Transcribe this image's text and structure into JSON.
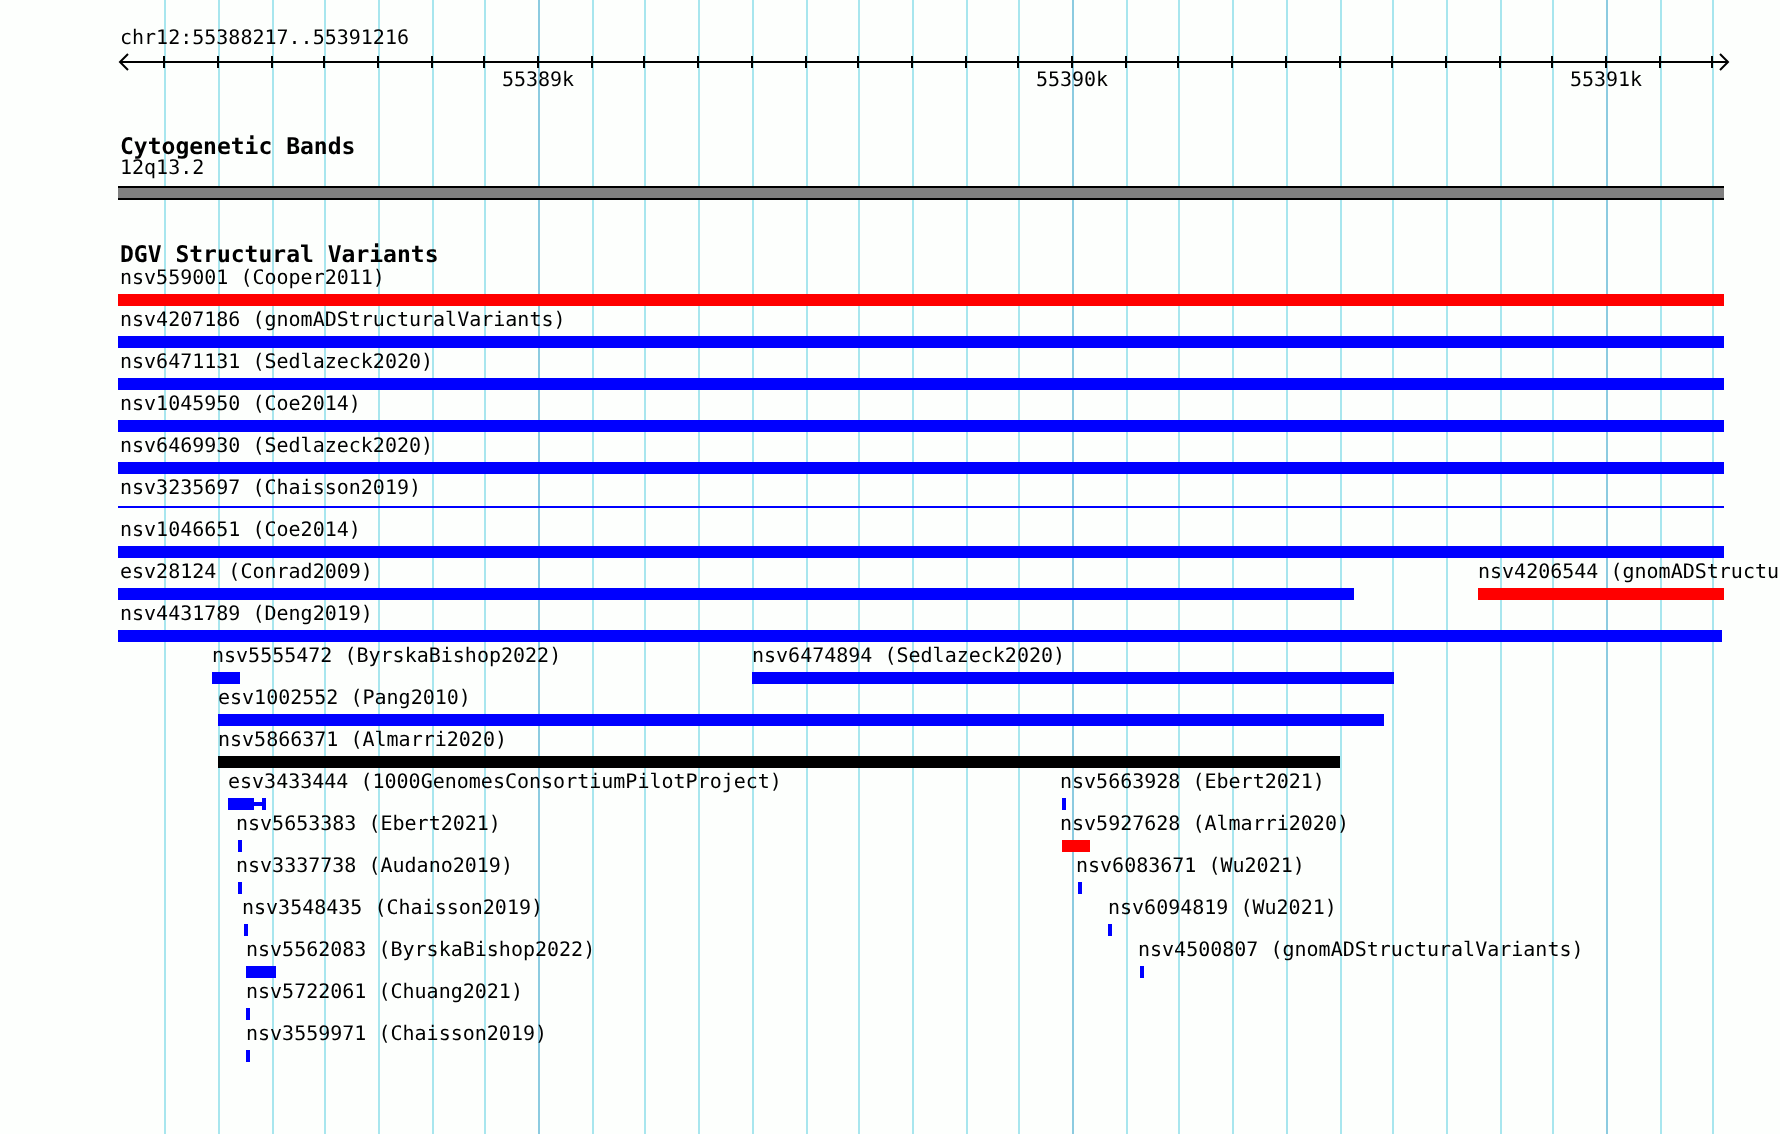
{
  "location": "chr12:55388217..55391216",
  "ruler": {
    "tick_labels": [
      "55389k",
      "55390k",
      "55391k"
    ]
  },
  "tracks": [
    {
      "title": "Cytogenetic Bands",
      "features": [
        {
          "label": "12q13.2",
          "kind": "band"
        }
      ]
    },
    {
      "title": "DGV Structural Variants",
      "features": [
        {
          "label": "nsv559001 (Cooper2011)",
          "kind": "bar",
          "color": "#ff0000"
        },
        {
          "label": "nsv4207186 (gnomADStructuralVariants)",
          "kind": "bar",
          "color": "#0000ff"
        },
        {
          "label": "nsv6471131 (Sedlazeck2020)",
          "kind": "bar",
          "color": "#0000ff"
        },
        {
          "label": "nsv1045950 (Coe2014)",
          "kind": "bar",
          "color": "#0000ff"
        },
        {
          "label": "nsv6469930 (Sedlazeck2020)",
          "kind": "bar",
          "color": "#0000ff"
        },
        {
          "label": "nsv3235697 (Chaisson2019)",
          "kind": "line",
          "color": "#0000ff"
        },
        {
          "label": "nsv1046651 (Coe2014)",
          "kind": "bar",
          "color": "#0000ff"
        },
        {
          "label": "esv28124 (Conrad2009)",
          "kind": "bar",
          "color": "#0000ff"
        },
        {
          "label": "nsv4206544 (gnomADStructu",
          "kind": "bar",
          "color": "#ff0000"
        },
        {
          "label": "nsv4431789 (Deng2019)",
          "kind": "bar",
          "color": "#0000ff"
        },
        {
          "label": "nsv5555472 (ByrskaBishop2022)",
          "kind": "bar",
          "color": "#0000ff"
        },
        {
          "label": "nsv6474894 (Sedlazeck2020)",
          "kind": "bar",
          "color": "#0000ff"
        },
        {
          "label": "esv1002552 (Pang2010)",
          "kind": "bar",
          "color": "#0000ff"
        },
        {
          "label": "nsv5866371 (Almarri2020)",
          "kind": "bar",
          "color": "#000000"
        },
        {
          "label": "esv3433444 (1000GenomesConsortiumPilotProject)",
          "kind": "dumbbell",
          "color": "#0000ff"
        },
        {
          "label": "nsv5663928 (Ebert2021)",
          "kind": "bar",
          "color": "#0000ff"
        },
        {
          "label": "nsv5653383 (Ebert2021)",
          "kind": "bar",
          "color": "#0000ff"
        },
        {
          "label": "nsv5927628 (Almarri2020)",
          "kind": "bar",
          "color": "#ff0000"
        },
        {
          "label": "nsv3337738 (Audano2019)",
          "kind": "bar",
          "color": "#0000ff"
        },
        {
          "label": "nsv6083671 (Wu2021)",
          "kind": "bar",
          "color": "#0000ff"
        },
        {
          "label": "nsv3548435 (Chaisson2019)",
          "kind": "bar",
          "color": "#0000ff"
        },
        {
          "label": "nsv6094819 (Wu2021)",
          "kind": "bar",
          "color": "#0000ff"
        },
        {
          "label": "nsv5562083 (ByrskaBishop2022)",
          "kind": "bar",
          "color": "#0000ff"
        },
        {
          "label": "nsv4500807 (gnomADStructuralVariants)",
          "kind": "bar",
          "color": "#0000ff"
        },
        {
          "label": "nsv5722061 (Chuang2021)",
          "kind": "bar",
          "color": "#0000ff"
        },
        {
          "label": "nsv3559971 (Chaisson2019)",
          "kind": "bar",
          "color": "#0000ff"
        }
      ]
    }
  ]
}
